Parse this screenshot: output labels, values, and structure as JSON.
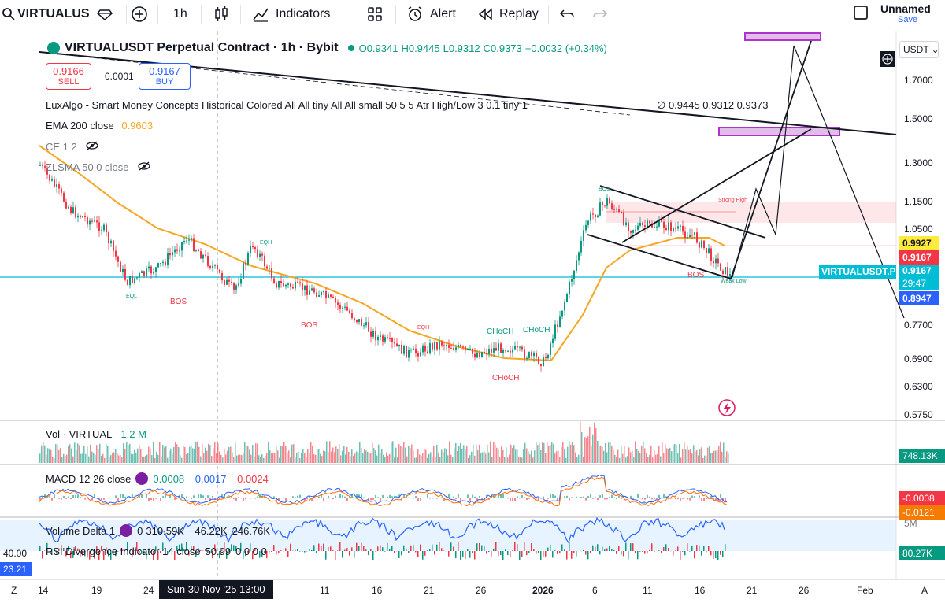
{
  "toolbar": {
    "symbol": "VIRTUALUS",
    "interval": "1h",
    "indicators_label": "Indicators",
    "alert_label": "Alert",
    "replay_label": "Replay",
    "layout_name": "Unnamed",
    "save_label": "Save"
  },
  "legend": {
    "title": "VIRTUALUSDT Perpetual Contract · 1h · Bybit",
    "ohlc_o": "O0.9341",
    "ohlc_h": "H0.9445",
    "ohlc_l": "L0.9312",
    "ohlc_c": "C0.9373",
    "ohlc_change": "+0.0032 (+0.34%)",
    "sell_price": "0.9166",
    "sell_label": "SELL",
    "spread": "0.0001",
    "buy_price": "0.9167",
    "buy_label": "BUY",
    "luxalgo": "LuxAlgo - Smart Money Concepts Historical Colored All All tiny All All small 50 5 5 Atr High/Low 3 0.1 tiny 1",
    "luxalgo_values": "0.9445  0.9312  0.9373",
    "ema_label": "EMA 200 close",
    "ema_value": "0.9603",
    "ce_label": "CE 1 2",
    "zlsma_label": "ZLSMA 50 0 close"
  },
  "price_axis": {
    "currency": "USDT",
    "ticks": [
      "1.7000",
      "1.5000",
      "1.3000",
      "1.1500",
      "1.0500",
      "0.7700",
      "0.6900",
      "0.6300",
      "0.5750"
    ],
    "tag_upper": "0.9927",
    "tag_red": "0.9167",
    "tag_symbol": "VIRTUALUSDT.P",
    "tag_last": "0.9167",
    "countdown": "29:47",
    "tag_lower": "0.8947"
  },
  "annotations": {
    "strong_high": "Strong High",
    "weak_low": "Weak Low",
    "bos": "BOS",
    "choch": "CHoCH",
    "eql": "EQL",
    "eqh": "EQH"
  },
  "volume": {
    "label": "Vol · VIRTUAL",
    "value": "1.2 M",
    "axis_tag": "748.13K"
  },
  "macd": {
    "label": "MACD 12 26 close",
    "v1": "0.0008",
    "v2": "−0.0017",
    "v3": "−0.0024",
    "axis_tag_1": "-0.0008",
    "axis_tag_2": "-0.0121"
  },
  "volume_delta": {
    "label": "Volume Delta 1",
    "v1": "0",
    "v2": "310.59K",
    "v3": "−46.22K",
    "v4": "246.76K",
    "axis_top": "5M",
    "axis_tag": "80.27K"
  },
  "rsi": {
    "label": "RSI Divergence Indicator 14 close",
    "v1": "50.99",
    "zeros": "0  0  0  0",
    "axis_left_top": "40.00",
    "axis_left_tag": "23.21"
  },
  "time_axis": {
    "labels": [
      "14",
      "19",
      "24",
      "11",
      "16",
      "21",
      "26",
      "2026",
      "6",
      "11",
      "16",
      "21",
      "26",
      "Feb"
    ],
    "cursor_label": "Sun 30 Nov '25   13:00"
  },
  "colors": {
    "up": "#089981",
    "down": "#f23645",
    "ema": "#f5a623",
    "cyan": "#00bcd4",
    "purple_zone": "#cc66ff",
    "sell_red": "#f23645",
    "buy_blue": "#2962ff"
  }
}
